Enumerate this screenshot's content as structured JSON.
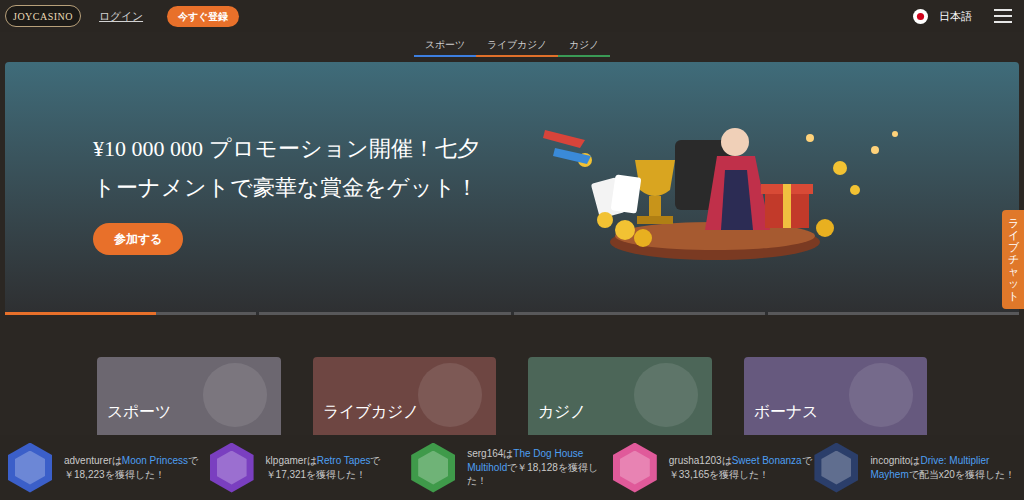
{
  "header": {
    "logo": "JOYCASINO",
    "login": "ログイン",
    "register": "今すぐ登録",
    "language": "日本語"
  },
  "tabs": [
    {
      "label": "スポーツ",
      "color": "#3d7fe0"
    },
    {
      "label": "ライブカジノ",
      "color": "#e0702a"
    },
    {
      "label": "カジノ",
      "color": "#3a9a55"
    }
  ],
  "hero": {
    "title": "¥10 000 000 プロモーション開催！七夕トーナメントで豪華な賞金をゲット！",
    "button": "参加する",
    "slides": [
      {
        "level": 0.6
      },
      {
        "level": 0
      },
      {
        "level": 0
      },
      {
        "level": 0
      }
    ]
  },
  "live_chat": "ライブチャット",
  "categories": [
    {
      "label": "スポーツ",
      "color": "#6c6770"
    },
    {
      "label": "ライブカジノ",
      "color": "#6e4642"
    },
    {
      "label": "カジノ",
      "color": "#4c6658"
    },
    {
      "label": "ボーナス",
      "color": "#66597e"
    }
  ],
  "winners": [
    {
      "user": "adventurer",
      "joiner": "は",
      "game": "Moon Princess",
      "result": "で￥18,223を獲得した！",
      "color": "#3b5fc9"
    },
    {
      "user": "klpgamer",
      "joiner": "は",
      "game": "Retro Tapes",
      "result": "で￥17,321を獲得した！",
      "color": "#7a3fc0"
    },
    {
      "user": "serg164",
      "joiner": "は",
      "game": "The Dog House Multihold",
      "result": "で￥18,128を獲得した！",
      "color": "#3f9a4a"
    },
    {
      "user": "grusha1203",
      "joiner": "は",
      "game": "Sweet Bonanza",
      "result": "で￥33,165を獲得した！",
      "color": "#e05a9a"
    },
    {
      "user": "incognito",
      "joiner": "は",
      "game": "Drive: Multiplier Mayhem",
      "result": "で配当x20を獲得した！",
      "color": "#2b3e6a"
    }
  ]
}
